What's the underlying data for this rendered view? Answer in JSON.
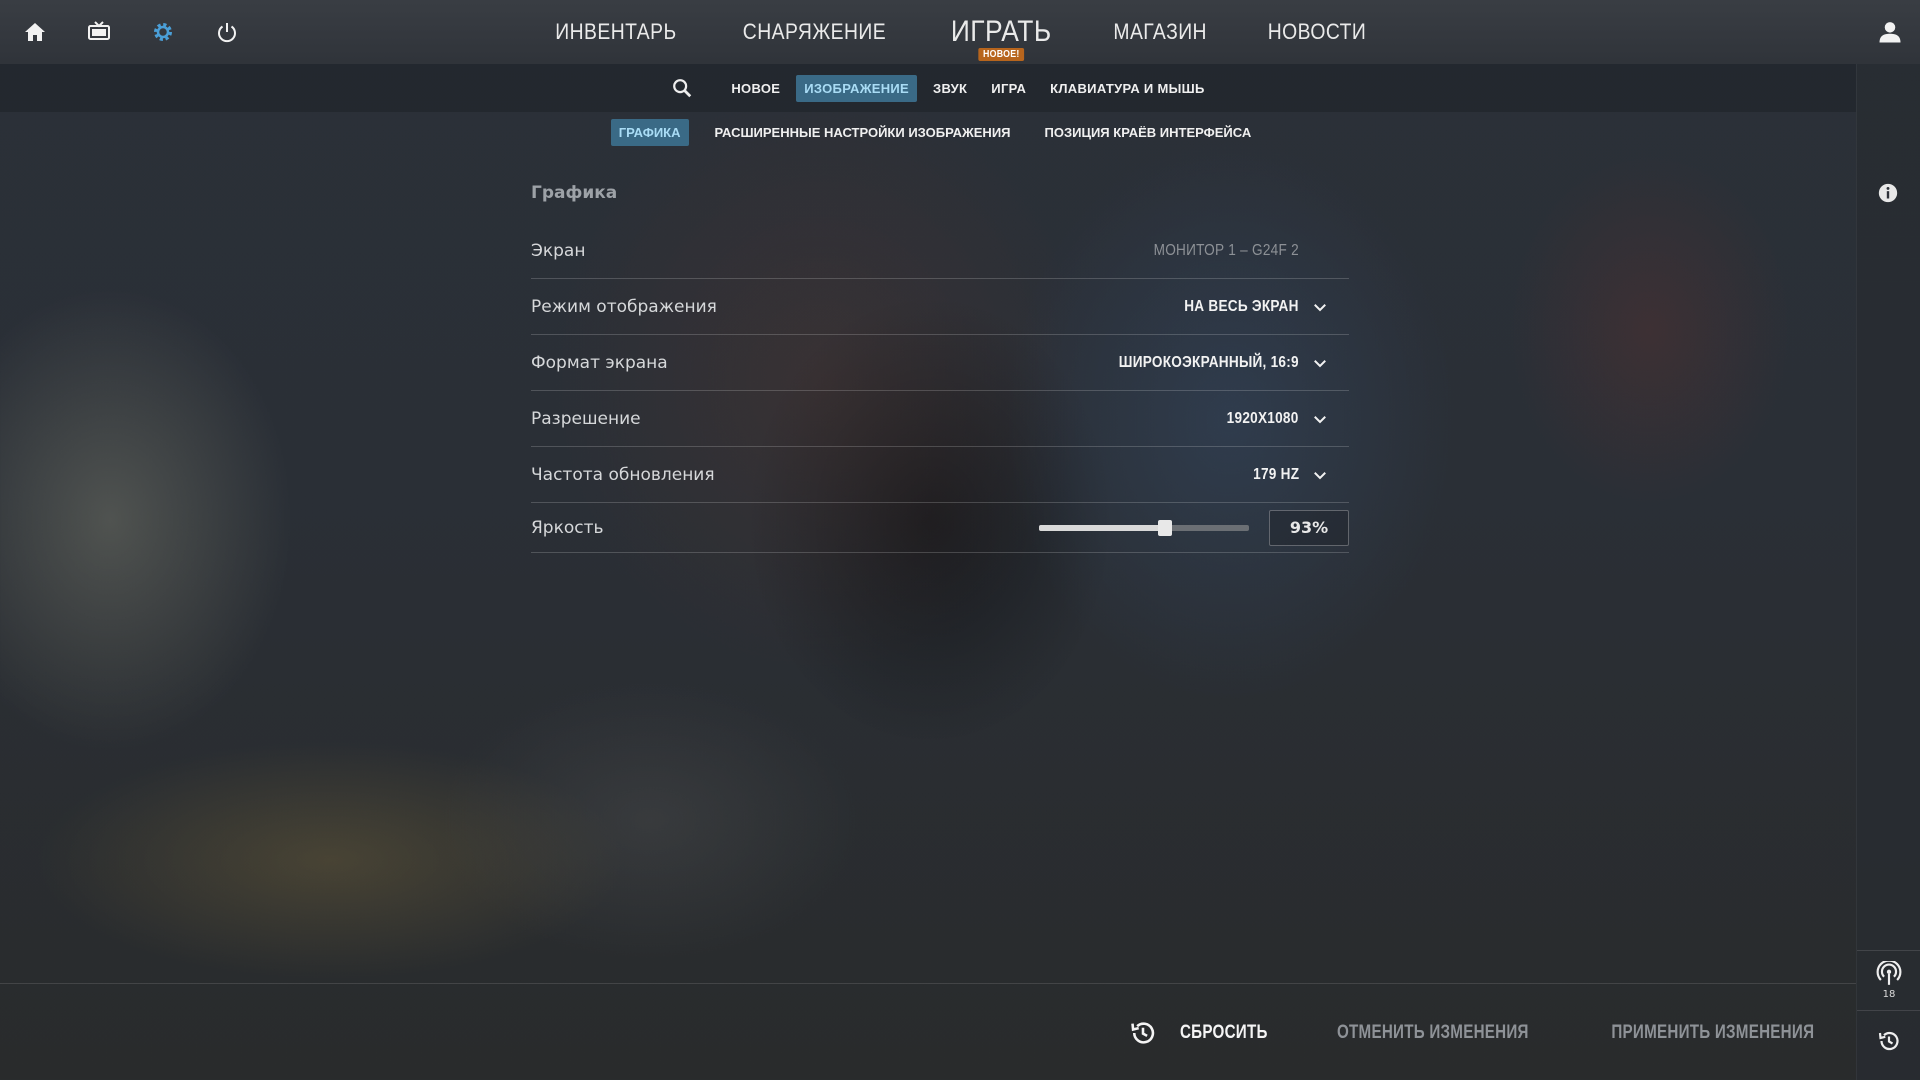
{
  "top_nav": {
    "items": [
      "ИНВЕНТАРЬ",
      "СНАРЯЖЕНИЕ",
      "ИГРАТЬ",
      "МАГАЗИН",
      "НОВОСТИ"
    ],
    "play_badge": "НОВОЕ!"
  },
  "settings_tabs": {
    "items": [
      "НОВОЕ",
      "ИЗОБРАЖЕНИЕ",
      "ЗВУК",
      "ИГРА",
      "КЛАВИАТУРА И МЫШЬ"
    ],
    "active": "ИЗОБРАЖЕНИЕ"
  },
  "sub_tabs": {
    "items": [
      "ГРАФИКА",
      "РАСШИРЕННЫЕ НАСТРОЙКИ ИЗОБРАЖЕНИЯ",
      "ПОЗИЦИЯ КРАЁВ ИНТЕРФЕЙСА"
    ],
    "active": "ГРАФИКА"
  },
  "section": {
    "title": "Графика",
    "rows": [
      {
        "label": "Экран",
        "value": "МОНИТОР 1 – G24F 2"
      },
      {
        "label": "Режим отображения",
        "value": "НА ВЕСЬ ЭКРАН"
      },
      {
        "label": "Формат экрана",
        "value": "ШИРОКОЭКРАННЫЙ, 16:9"
      },
      {
        "label": "Разрешение",
        "value": "1920X1080"
      },
      {
        "label": "Частота обновления",
        "value": "179 HZ"
      }
    ],
    "brightness": {
      "label": "Яркость",
      "value": "93%",
      "level": 0.6
    }
  },
  "right_rail": {
    "count": "18"
  },
  "bottom_bar": {
    "reset": "СБРОСИТЬ",
    "discard": "ОТМЕНИТЬ ИЗМЕНЕНИЯ",
    "apply": "ПРИМЕНИТЬ ИЗМЕНЕНИЯ"
  },
  "colors": {
    "accent_tab_bg": "#3a6a86",
    "accent_tab_text": "#a9dcf5",
    "badge": "#b7651d",
    "settings_icon": "#4a9fd8"
  },
  "icons": {
    "top": [
      "home-icon",
      "tv-icon",
      "gear-icon",
      "power-icon"
    ],
    "profile": "user-icon",
    "search": "search-icon",
    "info": "info-icon",
    "rail": [
      "broadcast-icon",
      "history-icon"
    ],
    "reset": "reset-icon"
  }
}
